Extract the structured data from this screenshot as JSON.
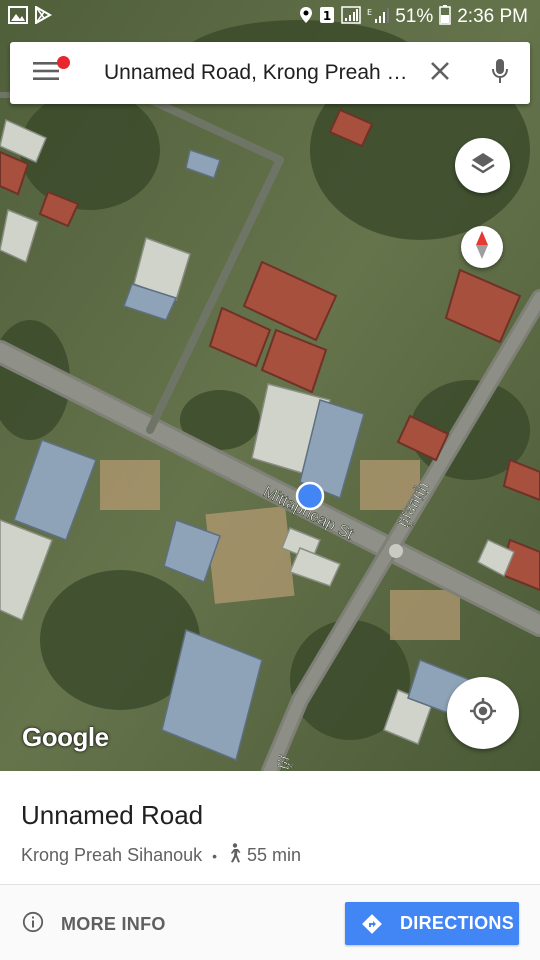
{
  "status_bar": {
    "battery_percent": "51%",
    "time": "2:36 PM",
    "icons": [
      "image-icon",
      "play-store-icon",
      "location-pin-icon",
      "sim-1-icon",
      "signal-icon",
      "data-signal-icon",
      "battery-icon"
    ]
  },
  "search": {
    "query": "Unnamed Road, Krong Preah Sih...",
    "icons": [
      "menu-icon",
      "clear-icon",
      "mic-icon"
    ]
  },
  "map": {
    "type": "satellite",
    "street_labels": [
      "Mittapheap St",
      "ផ្លូវ​ឧកញ៉ា",
      "ផ្លូវ"
    ],
    "logo": "Google",
    "controls": [
      "layers-icon",
      "compass-icon",
      "my-location-icon"
    ],
    "colors": {
      "location_dot": "#4285f4"
    }
  },
  "place": {
    "title": "Unnamed Road",
    "locality": "Krong Preah Sihanouk",
    "separator": "•",
    "walk_time": "55 min"
  },
  "actions": {
    "more_info": "MORE INFO",
    "directions": "DIRECTIONS"
  },
  "colors": {
    "accent": "#4285f4",
    "menu_badge": "#e8262b"
  }
}
